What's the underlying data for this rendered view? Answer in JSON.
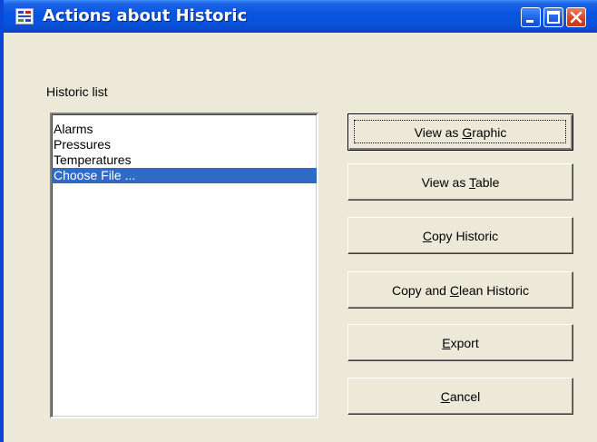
{
  "window": {
    "title": "Actions about Historic",
    "icon": "app-icon"
  },
  "historic": {
    "label": "Historic list",
    "items": [
      "Alarms",
      "Pressures",
      "Temperatures",
      "Choose File ..."
    ],
    "selected_index": 3
  },
  "buttons": {
    "view_graphic": {
      "pre": "View as ",
      "key": "G",
      "post": "raphic"
    },
    "view_table": {
      "pre": "View as ",
      "key": "T",
      "post": "able"
    },
    "copy_historic": {
      "pre": "",
      "key": "C",
      "post": "opy Historic"
    },
    "copy_clean": {
      "pre": "Copy and ",
      "key": "C",
      "post": "lean Historic"
    },
    "export": {
      "pre": "",
      "key": "E",
      "post": "xport"
    },
    "cancel": {
      "pre": "",
      "key": "C",
      "post": "ancel"
    }
  },
  "colors": {
    "titlebar": "#0a55e0",
    "selection": "#316ac5",
    "close_button": "#d34324"
  }
}
